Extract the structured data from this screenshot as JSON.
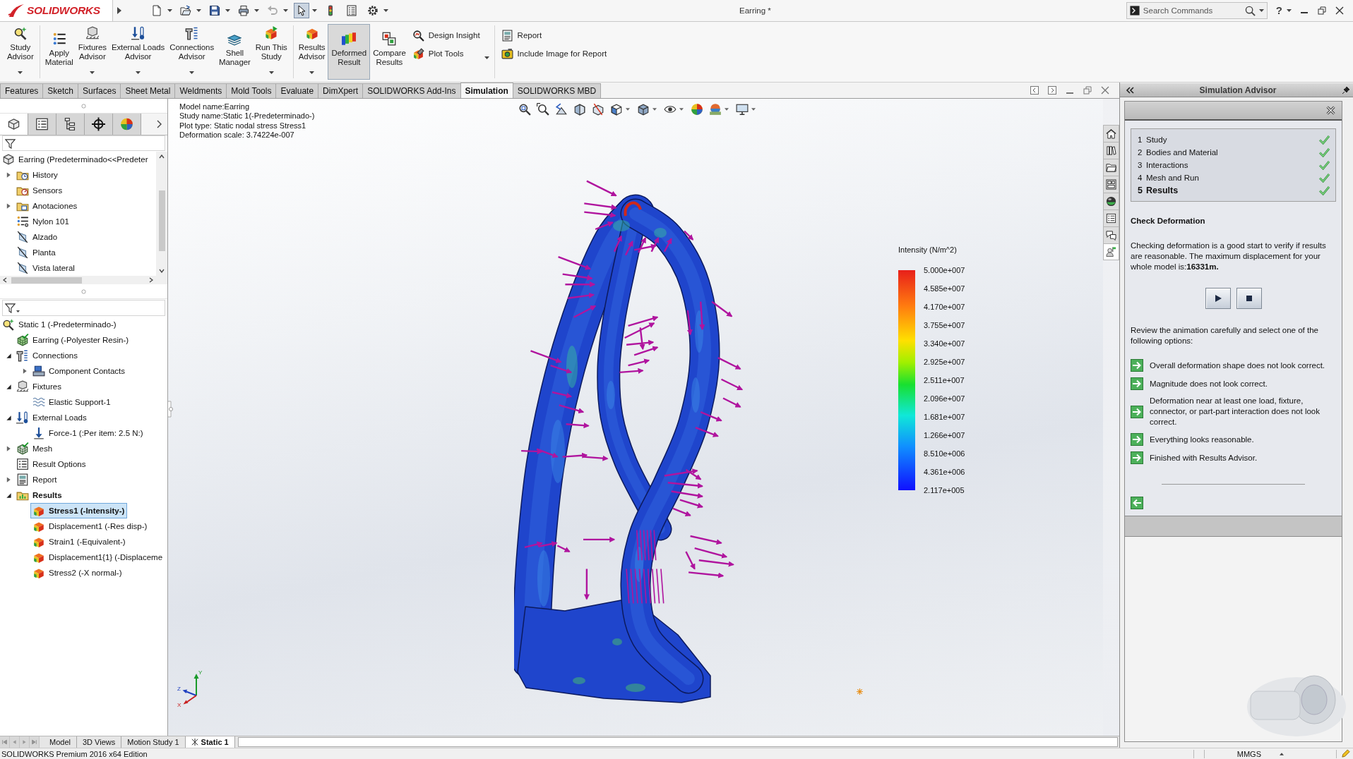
{
  "title_bar": {
    "logo": "SOLIDWORKS",
    "title": "Earring *",
    "search": {
      "placeholder": "Search Commands"
    },
    "help": "?"
  },
  "quick_access": [
    {
      "kind": "new",
      "dropdown": true,
      "selected": false,
      "disabled": false
    },
    {
      "kind": "open",
      "dropdown": true,
      "selected": false,
      "disabled": false
    },
    {
      "kind": "save",
      "dropdown": true,
      "selected": false,
      "disabled": false
    },
    {
      "kind": "print",
      "dropdown": true,
      "selected": false,
      "disabled": false
    },
    {
      "kind": "undo",
      "dropdown": true,
      "selected": false,
      "disabled": true
    },
    {
      "kind": "select",
      "dropdown": true,
      "selected": true,
      "disabled": false
    },
    {
      "kind": "rebuild",
      "dropdown": false,
      "selected": false,
      "disabled": false
    },
    {
      "kind": "file-properties",
      "dropdown": false,
      "selected": false,
      "disabled": false
    },
    {
      "kind": "options",
      "dropdown": true,
      "selected": false,
      "disabled": false
    }
  ],
  "ribbon": [
    [
      {
        "kind": "study-advisor",
        "label": "Study\nAdvisor",
        "dropdown": true,
        "selected": false
      }
    ],
    [
      {
        "kind": "apply-material",
        "label": "Apply\nMaterial",
        "dropdown": false,
        "selected": false
      },
      {
        "kind": "fixtures-advisor",
        "label": "Fixtures\nAdvisor",
        "dropdown": true,
        "selected": false
      },
      {
        "kind": "external-loads-advisor",
        "label": "External Loads\nAdvisor",
        "dropdown": true,
        "selected": false
      },
      {
        "kind": "connections-advisor",
        "label": "Connections\nAdvisor",
        "dropdown": true,
        "selected": false
      },
      {
        "kind": "shell-manager",
        "label": "Shell\nManager",
        "dropdown": false,
        "selected": false
      },
      {
        "kind": "run-study",
        "label": "Run This\nStudy",
        "dropdown": true,
        "selected": false
      }
    ],
    [
      {
        "kind": "results-advisor",
        "label": "Results\nAdvisor",
        "dropdown": true,
        "selected": false
      },
      {
        "kind": "deformed-result",
        "label": "Deformed\nResult",
        "dropdown": false,
        "selected": true
      },
      {
        "kind": "compare-results",
        "label": "Compare\nResults",
        "dropdown": false,
        "selected": false
      },
      {
        "kind": "stack",
        "dropdown": true,
        "buttons": [
          {
            "kind": "design-insight",
            "label": "Design Insight"
          },
          {
            "kind": "plot-tools",
            "label": "Plot Tools"
          }
        ]
      }
    ],
    [
      {
        "kind": "stack",
        "dropdown": false,
        "buttons": [
          {
            "kind": "report",
            "label": "Report"
          },
          {
            "kind": "include-image",
            "label": "Include Image for Report"
          }
        ]
      }
    ]
  ],
  "command_tabs": [
    {
      "label": "Features",
      "selected": false
    },
    {
      "label": "Sketch",
      "selected": false
    },
    {
      "label": "Surfaces",
      "selected": false
    },
    {
      "label": "Sheet Metal",
      "selected": false
    },
    {
      "label": "Weldments",
      "selected": false
    },
    {
      "label": "Mold Tools",
      "selected": false
    },
    {
      "label": "Evaluate",
      "selected": false
    },
    {
      "label": "DimXpert",
      "selected": false
    },
    {
      "label": "SOLIDWORKS Add-Ins",
      "selected": false
    },
    {
      "label": "Simulation",
      "selected": true
    },
    {
      "label": "SOLIDWORKS MBD",
      "selected": false
    }
  ],
  "feature_manager": {
    "tabs": [
      {
        "kind": "feature-tree",
        "selected": true
      },
      {
        "kind": "property-manager",
        "selected": false
      },
      {
        "kind": "configuration-manager",
        "selected": false
      },
      {
        "kind": "dimxpert-manager",
        "selected": false
      },
      {
        "kind": "display-manager",
        "selected": false
      }
    ],
    "tree": {
      "kind": "part",
      "label": "Earring (Predeterminado<<Predeter",
      "selected": false,
      "children": [
        {
          "kind": "history",
          "label": "History",
          "expandable": true,
          "expanded": false,
          "selected": false
        },
        {
          "kind": "sensors",
          "label": "Sensors",
          "expandable": false,
          "selected": false
        },
        {
          "kind": "annotations",
          "label": "Anotaciones",
          "expandable": true,
          "expanded": false,
          "selected": false
        },
        {
          "kind": "material",
          "label": "Nylon 101",
          "expandable": false,
          "selected": false
        },
        {
          "kind": "plane",
          "label": "Alzado",
          "expandable": false,
          "selected": false
        },
        {
          "kind": "plane",
          "label": "Planta",
          "expandable": false,
          "selected": false
        },
        {
          "kind": "plane",
          "label": "Vista lateral",
          "expandable": false,
          "selected": false
        }
      ]
    }
  },
  "simulation_tree": {
    "kind": "study",
    "label": "Static 1 (-Predeterminado-)",
    "selected": false,
    "active": false,
    "children": [
      {
        "kind": "body",
        "label": "Earring (-Polyester Resin-)",
        "expandable": false,
        "selected": false,
        "active": false
      },
      {
        "kind": "connections",
        "label": "Connections",
        "expandable": true,
        "expanded": true,
        "selected": false,
        "active": false,
        "children": [
          {
            "kind": "contacts",
            "label": "Component Contacts",
            "expandable": true,
            "expanded": false,
            "selected": false,
            "active": false
          }
        ]
      },
      {
        "kind": "fixtures",
        "label": "Fixtures",
        "expandable": true,
        "expanded": true,
        "selected": false,
        "active": false,
        "children": [
          {
            "kind": "elastic-support",
            "label": "Elastic Support-1",
            "expandable": false,
            "selected": false,
            "active": false
          }
        ]
      },
      {
        "kind": "external-loads",
        "label": "External Loads",
        "expandable": true,
        "expanded": true,
        "selected": false,
        "active": false,
        "children": [
          {
            "kind": "force",
            "label": "Force-1 (:Per item: 2.5 N:)",
            "expandable": false,
            "selected": false,
            "active": false
          }
        ]
      },
      {
        "kind": "mesh",
        "label": "Mesh",
        "expandable": true,
        "expanded": false,
        "selected": false,
        "active": false
      },
      {
        "kind": "result-options",
        "label": "Result Options",
        "expandable": false,
        "selected": false,
        "active": false
      },
      {
        "kind": "report",
        "label": "Report",
        "expandable": true,
        "expanded": false,
        "selected": false,
        "active": false
      },
      {
        "kind": "results",
        "label": "Results",
        "expandable": true,
        "expanded": true,
        "selected": false,
        "active": true,
        "children": [
          {
            "kind": "stress-plot",
            "label": "Stress1 (-Intensity-)",
            "expandable": false,
            "selected": true,
            "active": true
          },
          {
            "kind": "displacement-plot",
            "label": "Displacement1 (-Res disp-)",
            "expandable": false,
            "selected": false,
            "active": false
          },
          {
            "kind": "strain-plot",
            "label": "Strain1 (-Equivalent-)",
            "expandable": false,
            "selected": false,
            "active": false
          },
          {
            "kind": "displacement-plot",
            "label": "Displacement1{1} (-Displaceme",
            "expandable": false,
            "selected": false,
            "active": false
          },
          {
            "kind": "stress-plot",
            "label": "Stress2 (-X normal-)",
            "expandable": false,
            "selected": false,
            "active": false
          }
        ]
      }
    ]
  },
  "viewport": {
    "info": [
      "Model name:Earring",
      "Study name:Static 1(-Predeterminado-)",
      "Plot type: Static nodal stress Stress1",
      "Deformation scale: 3.74224e-007"
    ],
    "heads_up_toolbar": [
      {
        "kind": "zoom-fit",
        "dropdown": false
      },
      {
        "kind": "zoom-area",
        "dropdown": false
      },
      {
        "kind": "previous-view",
        "dropdown": false
      },
      {
        "kind": "section-view",
        "dropdown": false
      },
      {
        "kind": "annotation-view",
        "dropdown": false
      },
      {
        "kind": "view-orientation",
        "dropdown": true
      },
      {
        "kind": "display-style",
        "dropdown": true
      },
      {
        "kind": "hide-show",
        "dropdown": true
      },
      {
        "kind": "edit-appearance",
        "dropdown": false
      },
      {
        "kind": "apply-scene",
        "dropdown": true
      },
      {
        "kind": "view-settings",
        "dropdown": true
      }
    ],
    "legend": {
      "title": "Intensity (N/m^2)",
      "values": [
        "5.000e+007",
        "4.585e+007",
        "4.170e+007",
        "3.755e+007",
        "3.340e+007",
        "2.925e+007",
        "2.511e+007",
        "2.096e+007",
        "1.681e+007",
        "1.266e+007",
        "8.510e+006",
        "4.361e+006",
        "2.117e+005"
      ]
    },
    "triad": [
      "Y",
      "Z",
      "X"
    ]
  },
  "task_pane": {
    "title": "Simulation Advisor",
    "tabs": [
      {
        "kind": "home",
        "selected": false
      },
      {
        "kind": "library",
        "selected": false
      },
      {
        "kind": "folder",
        "selected": false
      },
      {
        "kind": "view-palette",
        "selected": false
      },
      {
        "kind": "appearances",
        "selected": false
      },
      {
        "kind": "properties",
        "selected": false
      },
      {
        "kind": "forum",
        "selected": false
      },
      {
        "kind": "advisor",
        "selected": true
      }
    ],
    "steps": [
      {
        "number": "1",
        "label": "Study",
        "done": true,
        "selected": false
      },
      {
        "number": "2",
        "label": "Bodies and Material",
        "done": true,
        "selected": false
      },
      {
        "number": "3",
        "label": "Interactions",
        "done": true,
        "selected": false
      },
      {
        "number": "4",
        "label": "Mesh and Run",
        "done": true,
        "selected": false
      },
      {
        "number": "5",
        "label": "Results",
        "done": true,
        "selected": true
      }
    ],
    "heading": "Check Deformation",
    "intro": "Checking deformation is a good start to verify if results are reasonable. The maximum displacement for your whole model is:**16331m.**",
    "prompt": "Review the animation carefully and select one of the following options:",
    "options": [
      "Overall deformation shape does not look correct.",
      "Magnitude does not look correct.",
      "Deformation near at least one load, fixture, connector, or part-part interaction does not look correct.",
      "Everything looks reasonable.",
      "Finished with Results Advisor."
    ]
  },
  "bottom_tabs": [
    {
      "kind": "model",
      "label": "Model",
      "selected": false
    },
    {
      "kind": "views",
      "label": "3D Views",
      "selected": false
    },
    {
      "kind": "motion",
      "label": "Motion Study 1",
      "selected": false
    },
    {
      "kind": "study",
      "label": "Static 1",
      "selected": true
    }
  ],
  "status_bar": {
    "product": "SOLIDWORKS Premium 2016 x64 Edition",
    "units": "MMGS"
  }
}
